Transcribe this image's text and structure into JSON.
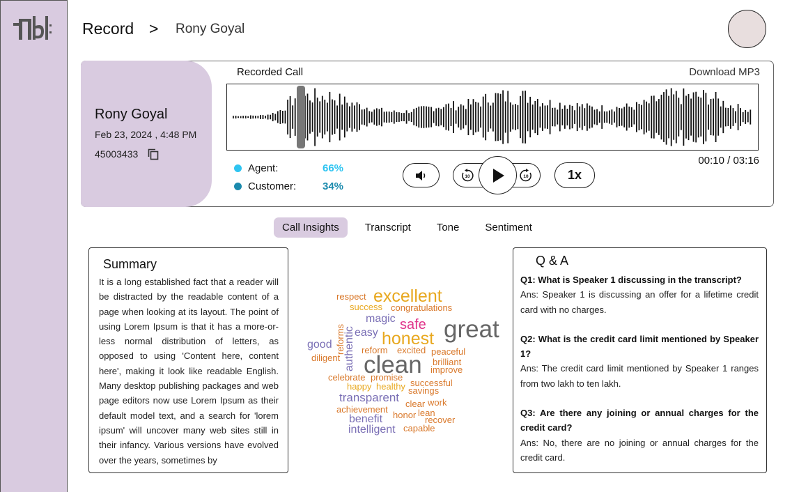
{
  "header": {
    "title": "Record",
    "separator": ">",
    "caller_name": "Rony Goyal"
  },
  "caller": {
    "name": "Rony Goyal",
    "date": "Feb 23, 2024 , 4:48 PM",
    "id": "45003433"
  },
  "player": {
    "label": "Recorded Call",
    "download_label": "Download MP3",
    "time": "00:10 / 03:16",
    "speed": "1x",
    "progress": 0.051,
    "agent_label": "Agent:",
    "agent_value": "66%",
    "customer_label": "Customer:",
    "customer_value": "34%",
    "agent_color": "#2ec4f1",
    "customer_color": "#1b8aad",
    "skip_back_label": "10",
    "skip_forward_label": "10"
  },
  "tabs": [
    "Call Insights",
    "Transcript",
    "Tone",
    "Sentiment"
  ],
  "summary": {
    "title": "Summary",
    "text": "It is a long established fact that a reader will be distracted by the readable content of a page when looking at its layout. The point of using Lorem Ipsum is that it has a more-or-less normal distribution of letters, as opposed to using 'Content here, content here', making it look like readable English. Many desktop publishing packages and web page editors now use Lorem Ipsum as their default model text, and a search for 'lorem ipsum' will uncover many web sites still in their infancy. Various versions have evolved over the years, sometimes by"
  },
  "word_cloud": [
    "respect",
    "excellent",
    "success",
    "congratulations",
    "magic",
    "safe",
    "great",
    "reforms",
    "authentic",
    "easy",
    "honest",
    "good",
    "diligent",
    "reform",
    "excited",
    "peaceful",
    "clean",
    "brilliant",
    "improve",
    "celebrate",
    "promise",
    "happy",
    "healthy",
    "successful",
    "savings",
    "transparent",
    "clear",
    "work",
    "achievement",
    "lean",
    "honor",
    "recover",
    "benefit",
    "intelligent",
    "capable"
  ],
  "qa": {
    "title": "Q & A",
    "items": [
      {
        "question": "Q1: What is Speaker 1 discussing in the transcript?",
        "answer": "Ans: Speaker 1 is discussing an offer for a lifetime credit card with no charges."
      },
      {
        "question": "Q2: What is the credit card limit mentioned by Speaker 1?",
        "answer": "Ans: The credit card limit mentioned by Speaker 1 ranges from two lakh to ten lakh."
      },
      {
        "question": "Q3: Are there any joining or annual charges for the credit card?",
        "answer": "Ans: No, there are no joining or annual charges for the credit card."
      }
    ]
  }
}
